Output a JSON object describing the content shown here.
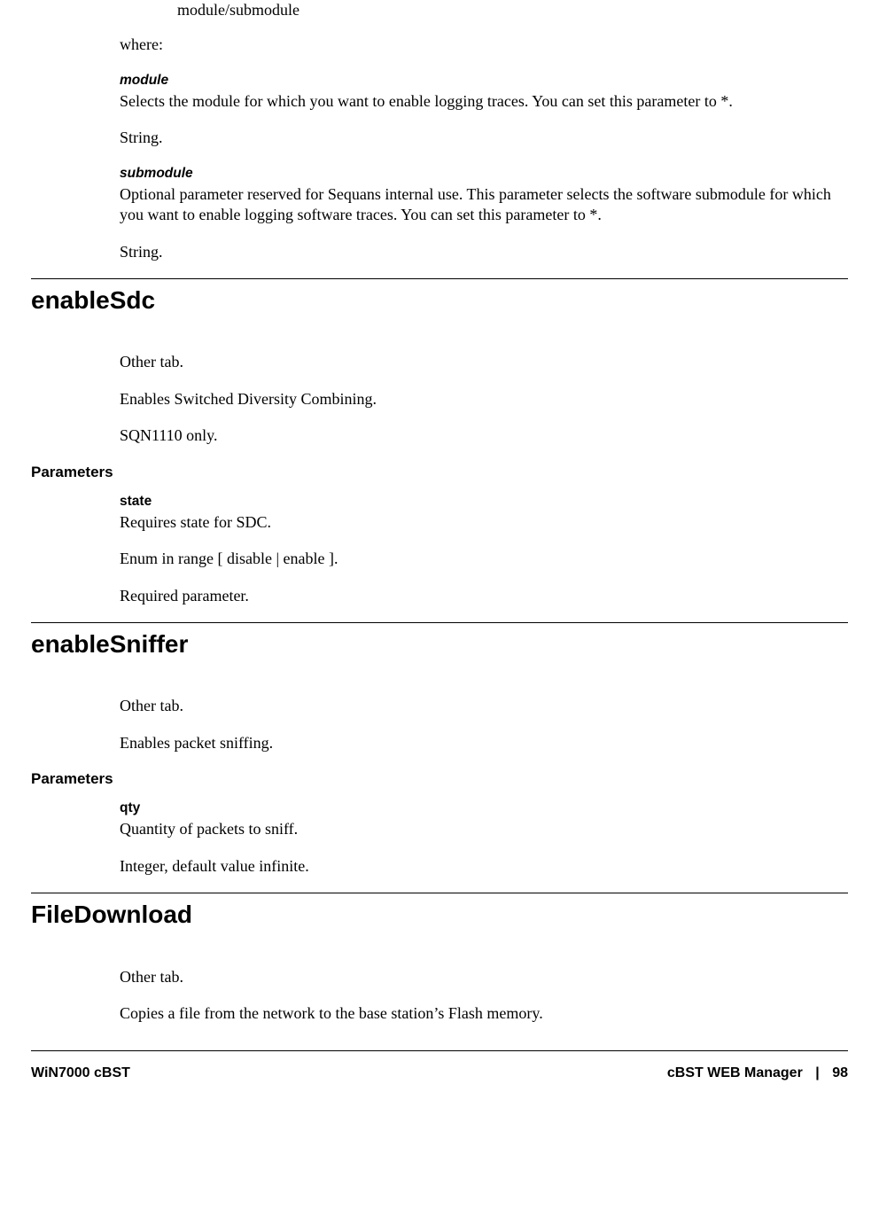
{
  "topSyntax": "module/submodule",
  "where": "where:",
  "moduleTerm": "module",
  "moduleDesc": "Selects the module for which you want to enable logging traces. You can set this parameter to *.",
  "moduleType": "String.",
  "submoduleTerm": "submodule",
  "submoduleDesc": "Optional parameter reserved for Sequans internal use. This parameter selects the software submodule for which you want to enable logging software traces. You can set this parameter to *.",
  "submoduleType": "String.",
  "sec1": {
    "title": "enableSdc",
    "p1": "Other tab.",
    "p2": "Enables Switched Diversity Combining.",
    "p3": "SQN1110 only.",
    "paramsHeading": "Parameters",
    "stateTerm": "state",
    "stateDesc": "Requires state for SDC.",
    "stateRange": "Enum in range [ disable | enable ].",
    "stateReq": "Required parameter."
  },
  "sec2": {
    "title": "enableSniffer",
    "p1": "Other tab.",
    "p2": "Enables packet sniffing.",
    "paramsHeading": "Parameters",
    "qtyTerm": "qty",
    "qtyDesc": "Quantity of packets to sniff.",
    "qtyType": "Integer, default value infinite."
  },
  "sec3": {
    "title": "FileDownload",
    "p1": "Other tab.",
    "p2": "Copies a file from the network to the base station’s Flash memory."
  },
  "footer": {
    "left": "WiN7000 cBST",
    "rightTitle": "cBST WEB Manager",
    "sep": "|",
    "page": "98"
  }
}
